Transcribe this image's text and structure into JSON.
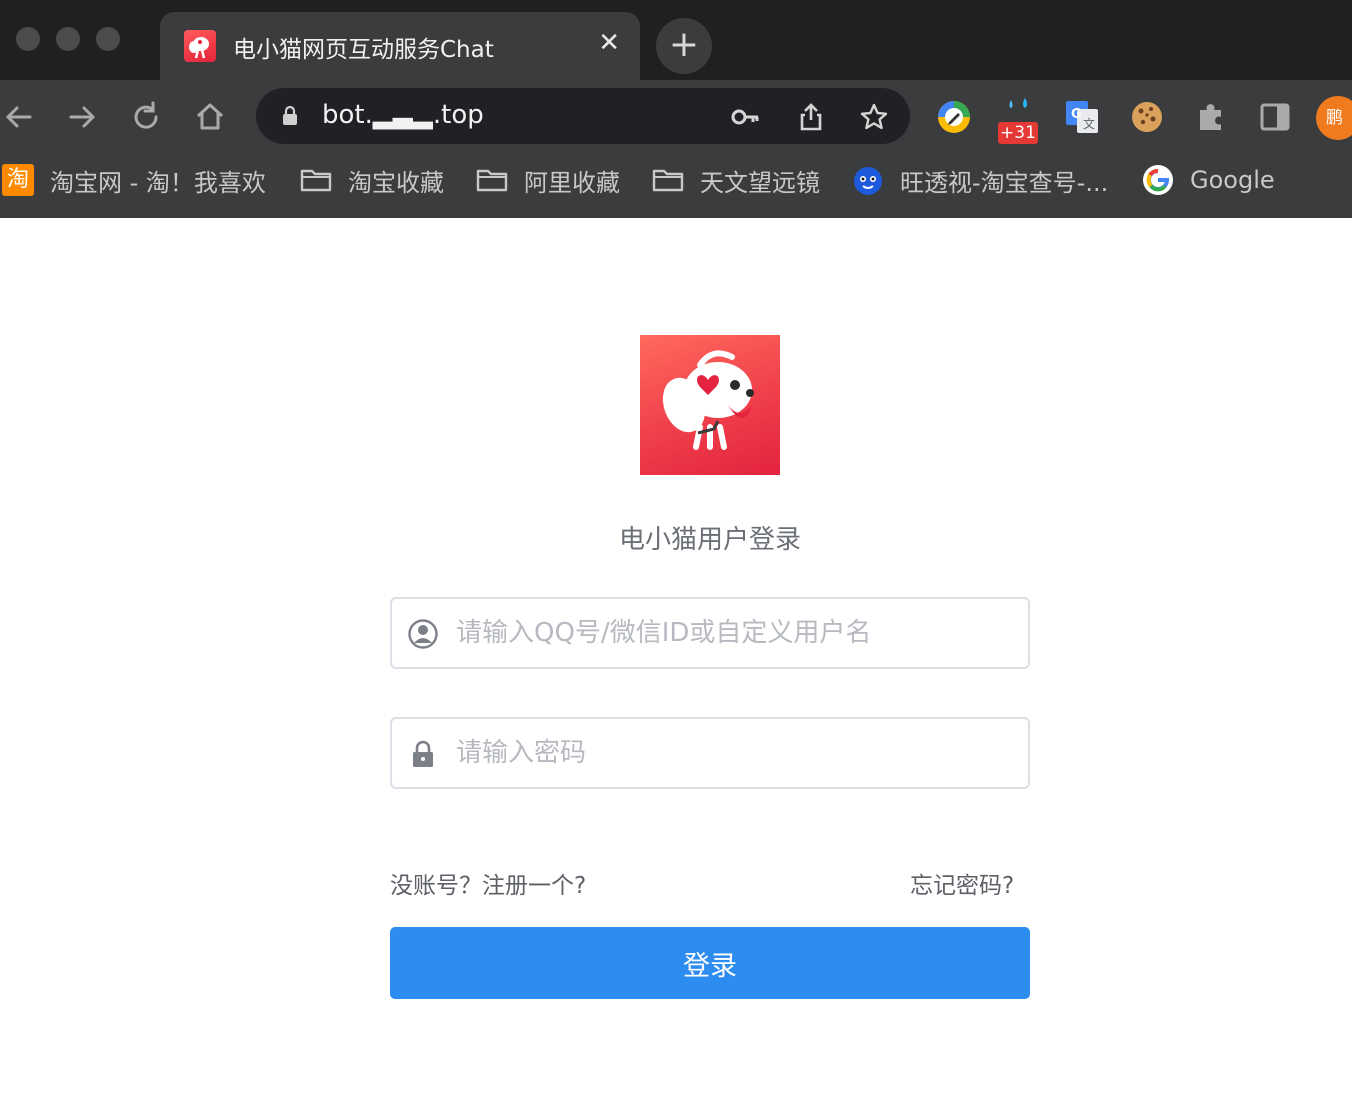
{
  "browser": {
    "tab": {
      "title": "电小猫网页互动服务Chat",
      "close_label": "✕",
      "favicon": "dianxiaomao-logo-icon"
    },
    "new_tab_label": "+",
    "url": "bot.▂▃▂.top",
    "extensions": [
      {
        "name": "pen-extension-icon"
      },
      {
        "name": "droplet-extension-icon",
        "badge": "+31"
      },
      {
        "name": "translate-extension-icon"
      },
      {
        "name": "cookie-extension-icon"
      },
      {
        "name": "puzzle-icon"
      },
      {
        "name": "sidepanel-icon"
      }
    ],
    "profile_label": "鹏",
    "bookmarks": [
      {
        "label": "淘宝网 - 淘！我喜欢",
        "icon": "taobao-icon",
        "icon_text": "淘"
      },
      {
        "label": "淘宝收藏",
        "icon": "folder-icon"
      },
      {
        "label": "阿里收藏",
        "icon": "folder-icon"
      },
      {
        "label": "天文望远镜",
        "icon": "folder-icon"
      },
      {
        "label": "旺透视-淘宝查号-...",
        "icon": "wangtoushi-icon"
      },
      {
        "label": "Google",
        "icon": "google-icon"
      }
    ]
  },
  "login": {
    "title": "电小猫用户登录",
    "username_placeholder": "请输入QQ号/微信ID或自定义用户名",
    "password_placeholder": "请输入密码",
    "register_link": "没账号？注册一个?",
    "forgot_link": "忘记密码?",
    "submit_label": "登录"
  },
  "colors": {
    "primary": "#2d8cf0",
    "brand_red": "#f03f4a",
    "profile_orange": "#f07b1e"
  }
}
